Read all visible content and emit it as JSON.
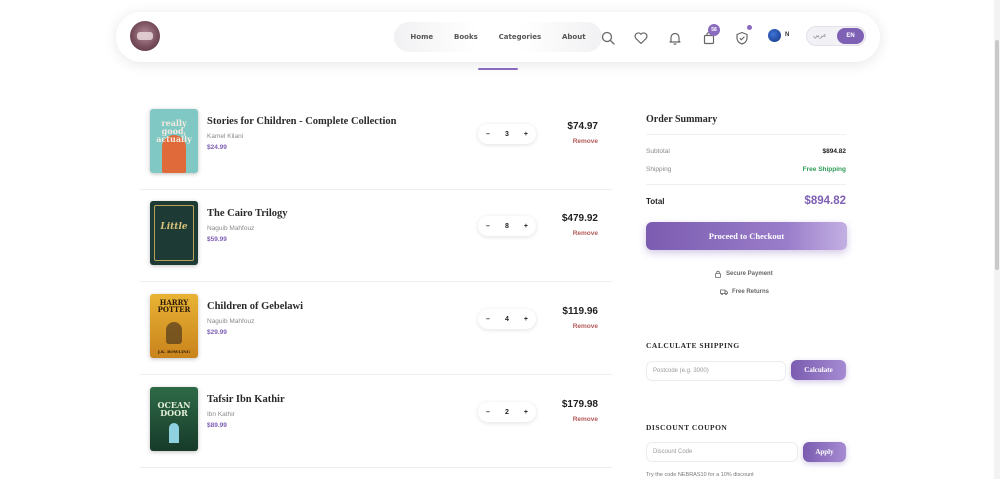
{
  "nav": {
    "links": [
      "Home",
      "Books",
      "Categories",
      "About"
    ],
    "cart_count": "58",
    "region": "N",
    "lang_ar": "عربي",
    "lang_en": "EN"
  },
  "cart": {
    "items": [
      {
        "title": "Stories for Children - Complete Collection",
        "author": "Kamel Kilani",
        "unit_price": "$24.99",
        "qty": "3",
        "line_total": "$74.97",
        "remove": "Remove",
        "cover_text": "really good, actually"
      },
      {
        "title": "The Cairo Trilogy",
        "author": "Naguib Mahfouz",
        "unit_price": "$59.99",
        "qty": "8",
        "line_total": "$479.92",
        "remove": "Remove",
        "cover_text": "Little"
      },
      {
        "title": "Children of Gebelawi",
        "author": "Naguib Mahfouz",
        "unit_price": "$29.99",
        "qty": "4",
        "line_total": "$119.96",
        "remove": "Remove",
        "cover_text": "HARRY POTTER",
        "cover_author": "J.K. ROWLING"
      },
      {
        "title": "Tafsir Ibn Kathir",
        "author": "Ibn Kathir",
        "unit_price": "$89.99",
        "qty": "2",
        "line_total": "$179.98",
        "remove": "Remove",
        "cover_text": "OCEAN DOOR"
      }
    ]
  },
  "summary": {
    "title": "Order Summary",
    "subtotal_label": "Subtotal",
    "subtotal_value": "$894.82",
    "shipping_label": "Shipping",
    "shipping_value": "Free Shipping",
    "total_label": "Total",
    "total_value": "$894.82",
    "checkout_label": "Proceed to Checkout",
    "secure_label": "Secure Payment",
    "returns_label": "Free Returns"
  },
  "shipping": {
    "title": "CALCULATE SHIPPING",
    "placeholder": "Postcode (e.g. 3000)",
    "button": "Calculate"
  },
  "coupon": {
    "title": "DISCOUNT COUPON",
    "placeholder": "Discount Code",
    "button": "Apply",
    "hint": "Try the code NEBRAS10 for a 10% discount"
  },
  "colors": {
    "accent": "#7e60b5",
    "free_shipping": "#2d9b57",
    "remove": "#b35a5a"
  }
}
